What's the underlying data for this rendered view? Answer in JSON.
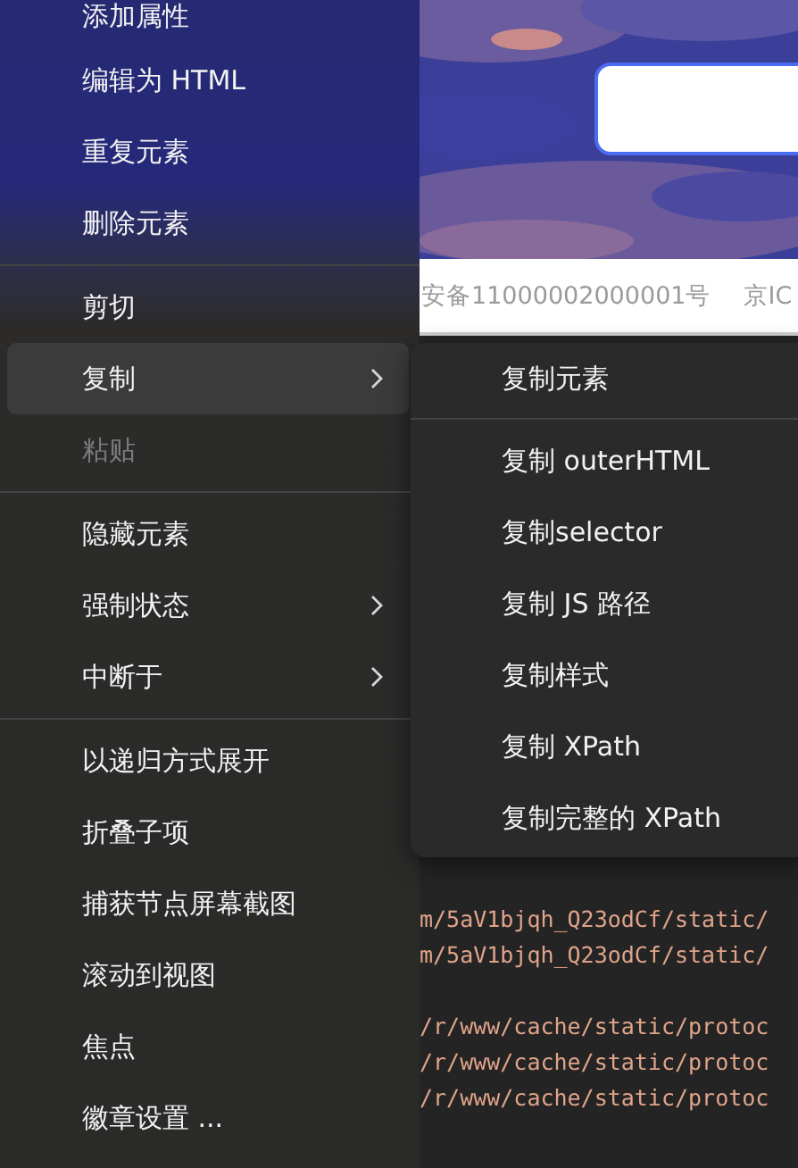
{
  "context_menu": {
    "items": [
      {
        "kind": "item",
        "label": "添加属性",
        "selected": false,
        "disabled": false,
        "has_submenu": false
      },
      {
        "kind": "item",
        "label": "编辑为 HTML",
        "selected": false,
        "disabled": false,
        "has_submenu": false
      },
      {
        "kind": "item",
        "label": "重复元素",
        "selected": false,
        "disabled": false,
        "has_submenu": false
      },
      {
        "kind": "item",
        "label": "删除元素",
        "selected": false,
        "disabled": false,
        "has_submenu": false
      },
      {
        "kind": "separator"
      },
      {
        "kind": "item",
        "label": "剪切",
        "selected": false,
        "disabled": false,
        "has_submenu": false
      },
      {
        "kind": "item",
        "label": "复制",
        "selected": true,
        "disabled": false,
        "has_submenu": true
      },
      {
        "kind": "item",
        "label": "粘贴",
        "selected": false,
        "disabled": true,
        "has_submenu": false
      },
      {
        "kind": "separator"
      },
      {
        "kind": "item",
        "label": "隐藏元素",
        "selected": false,
        "disabled": false,
        "has_submenu": false
      },
      {
        "kind": "item",
        "label": "强制状态",
        "selected": false,
        "disabled": false,
        "has_submenu": true
      },
      {
        "kind": "item",
        "label": "中断于",
        "selected": false,
        "disabled": false,
        "has_submenu": true
      },
      {
        "kind": "separator"
      },
      {
        "kind": "item",
        "label": "以递归方式展开",
        "selected": false,
        "disabled": false,
        "has_submenu": false
      },
      {
        "kind": "item",
        "label": "折叠子项",
        "selected": false,
        "disabled": false,
        "has_submenu": false
      },
      {
        "kind": "item",
        "label": "捕获节点屏幕截图",
        "selected": false,
        "disabled": false,
        "has_submenu": false
      },
      {
        "kind": "item",
        "label": "滚动到视图",
        "selected": false,
        "disabled": false,
        "has_submenu": false
      },
      {
        "kind": "item",
        "label": "焦点",
        "selected": false,
        "disabled": false,
        "has_submenu": false
      },
      {
        "kind": "item",
        "label": "徽章设置 ...",
        "selected": false,
        "disabled": false,
        "has_submenu": false
      }
    ]
  },
  "submenu": {
    "items": [
      {
        "kind": "item",
        "label": "复制元素"
      },
      {
        "kind": "separator"
      },
      {
        "kind": "item",
        "label": "复制 outerHTML"
      },
      {
        "kind": "item",
        "label": "复制selector"
      },
      {
        "kind": "item",
        "label": "复制 JS 路径"
      },
      {
        "kind": "item",
        "label": "复制样式"
      },
      {
        "kind": "item",
        "label": "复制 XPath"
      },
      {
        "kind": "item",
        "label": "复制完整的 XPath"
      }
    ]
  },
  "page": {
    "footer": [
      "安备11000002000001号",
      "京IC"
    ]
  },
  "code_groups": [
    {
      "lines": [
        "m/5aV1bjqh_Q23odCf/static/",
        "m/5aV1bjqh_Q23odCf/static/"
      ]
    },
    {
      "lines": [
        "/r/www/cache/static/protoc",
        "/r/www/cache/static/protoc",
        "/r/www/cache/static/protoc"
      ]
    }
  ]
}
